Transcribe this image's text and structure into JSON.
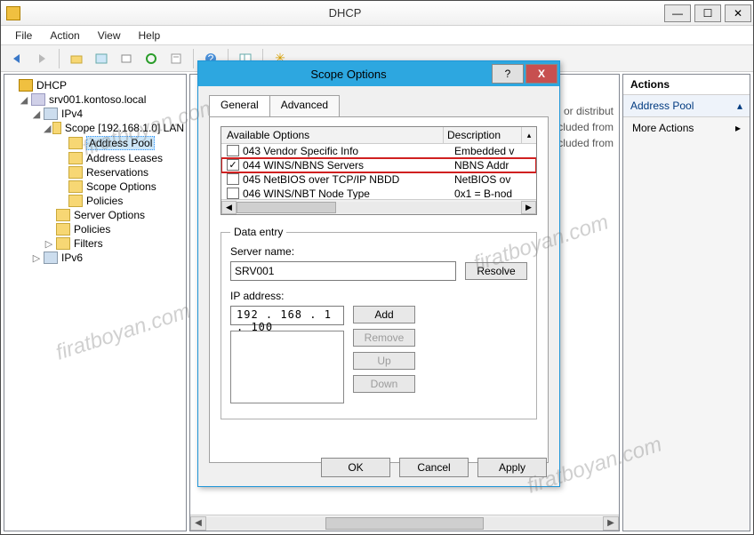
{
  "window": {
    "title": "DHCP"
  },
  "menus": {
    "file": "File",
    "action": "Action",
    "view": "View",
    "help": "Help"
  },
  "tree": {
    "root": "DHCP",
    "server": "srv001.kontoso.local",
    "ipv4": "IPv4",
    "scope": "Scope [192.168.1.0] LAN",
    "address_pool": "Address Pool",
    "address_leases": "Address Leases",
    "reservations": "Reservations",
    "scope_options": "Scope Options",
    "policies_scope": "Policies",
    "server_options": "Server Options",
    "policies_server": "Policies",
    "filters": "Filters",
    "ipv6": "IPv6"
  },
  "mid": {
    "line1": "or distribut",
    "line2": "cluded from",
    "line3": "cluded from"
  },
  "actions": {
    "header": "Actions",
    "section": "Address Pool",
    "more": "More Actions"
  },
  "dialog": {
    "title": "Scope Options",
    "help": "?",
    "close": "X",
    "tab_general": "General",
    "tab_advanced": "Advanced",
    "col_options": "Available Options",
    "col_desc": "Description",
    "options": [
      {
        "checked": false,
        "name": "043 Vendor Specific Info",
        "desc": "Embedded v"
      },
      {
        "checked": true,
        "name": "044 WINS/NBNS Servers",
        "desc": "NBNS Addr",
        "highlight": true
      },
      {
        "checked": false,
        "name": "045 NetBIOS over TCP/IP NBDD",
        "desc": "NetBIOS ov"
      },
      {
        "checked": false,
        "name": "046 WINS/NBT Node Type",
        "desc": "0x1 = B-nod"
      }
    ],
    "data_entry_legend": "Data entry",
    "server_name_label": "Server name:",
    "server_name_value": "SRV001",
    "resolve": "Resolve",
    "ip_label": "IP address:",
    "ip_value": "192 . 168 .   1  . 100",
    "add": "Add",
    "remove": "Remove",
    "up": "Up",
    "down": "Down",
    "ok": "OK",
    "cancel": "Cancel",
    "apply": "Apply"
  },
  "watermark": "firatboyan.com"
}
